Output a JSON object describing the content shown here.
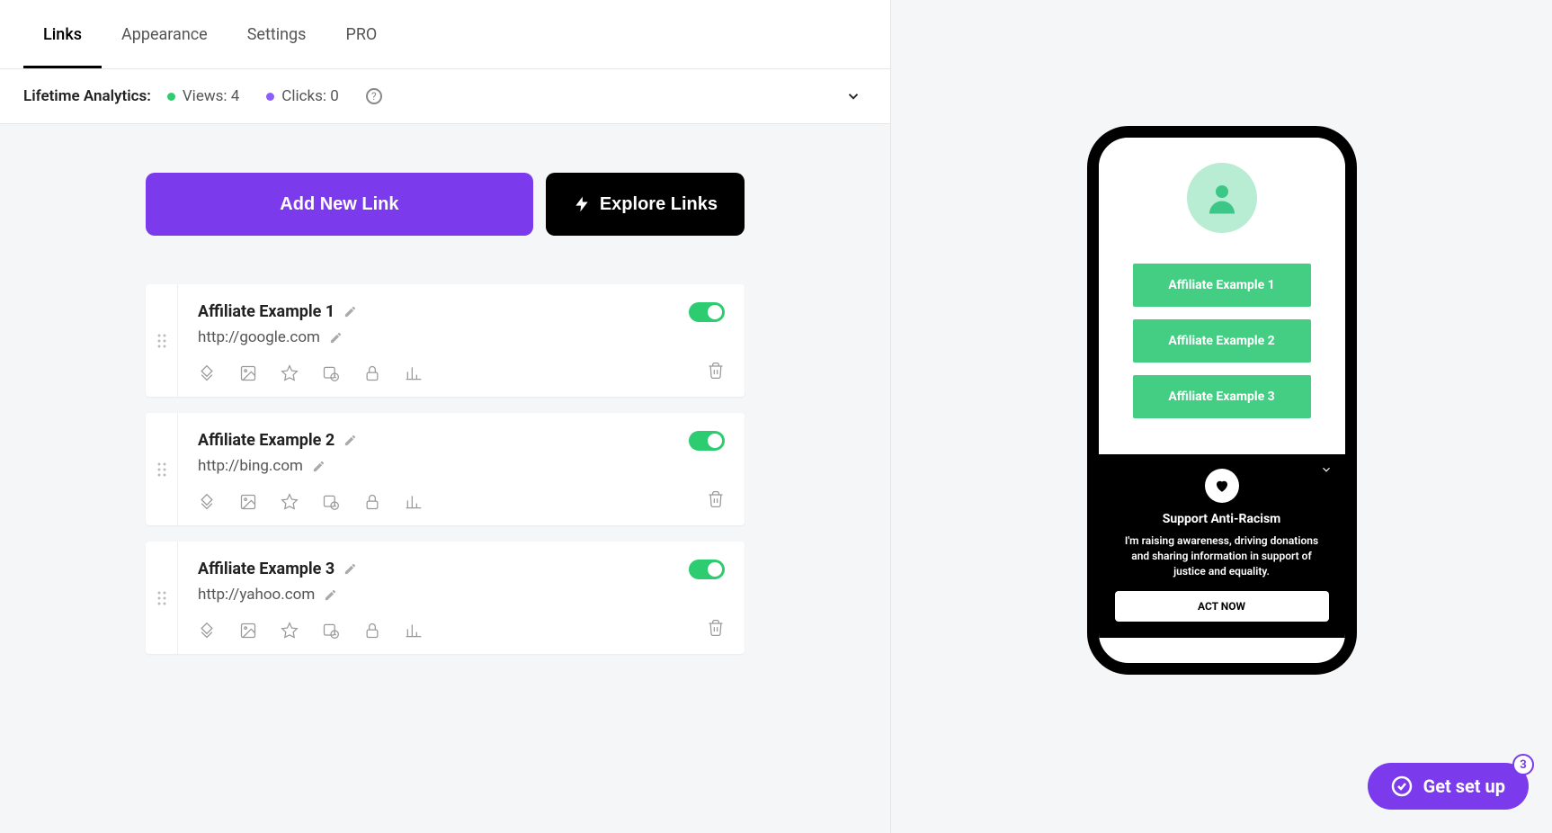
{
  "tabs": [
    "Links",
    "Appearance",
    "Settings",
    "PRO"
  ],
  "active_tab": 0,
  "analytics": {
    "label": "Lifetime Analytics:",
    "views_label": "Views: 4",
    "clicks_label": "Clicks: 0"
  },
  "actions": {
    "add": "Add New Link",
    "explore": "Explore Links"
  },
  "links": [
    {
      "title": "Affiliate Example 1",
      "url": "http://google.com",
      "enabled": true
    },
    {
      "title": "Affiliate Example 2",
      "url": "http://bing.com",
      "enabled": true
    },
    {
      "title": "Affiliate Example 3",
      "url": "http://yahoo.com",
      "enabled": true
    }
  ],
  "preview": {
    "links": [
      "Affiliate Example 1",
      "Affiliate Example 2",
      "Affiliate Example 3"
    ],
    "banner_title": "Support Anti-Racism",
    "banner_text": "I'm raising awareness, driving donations and sharing information in support of justice and equality.",
    "cta": "ACT NOW"
  },
  "setup": {
    "label": "Get set up",
    "count": "3"
  }
}
